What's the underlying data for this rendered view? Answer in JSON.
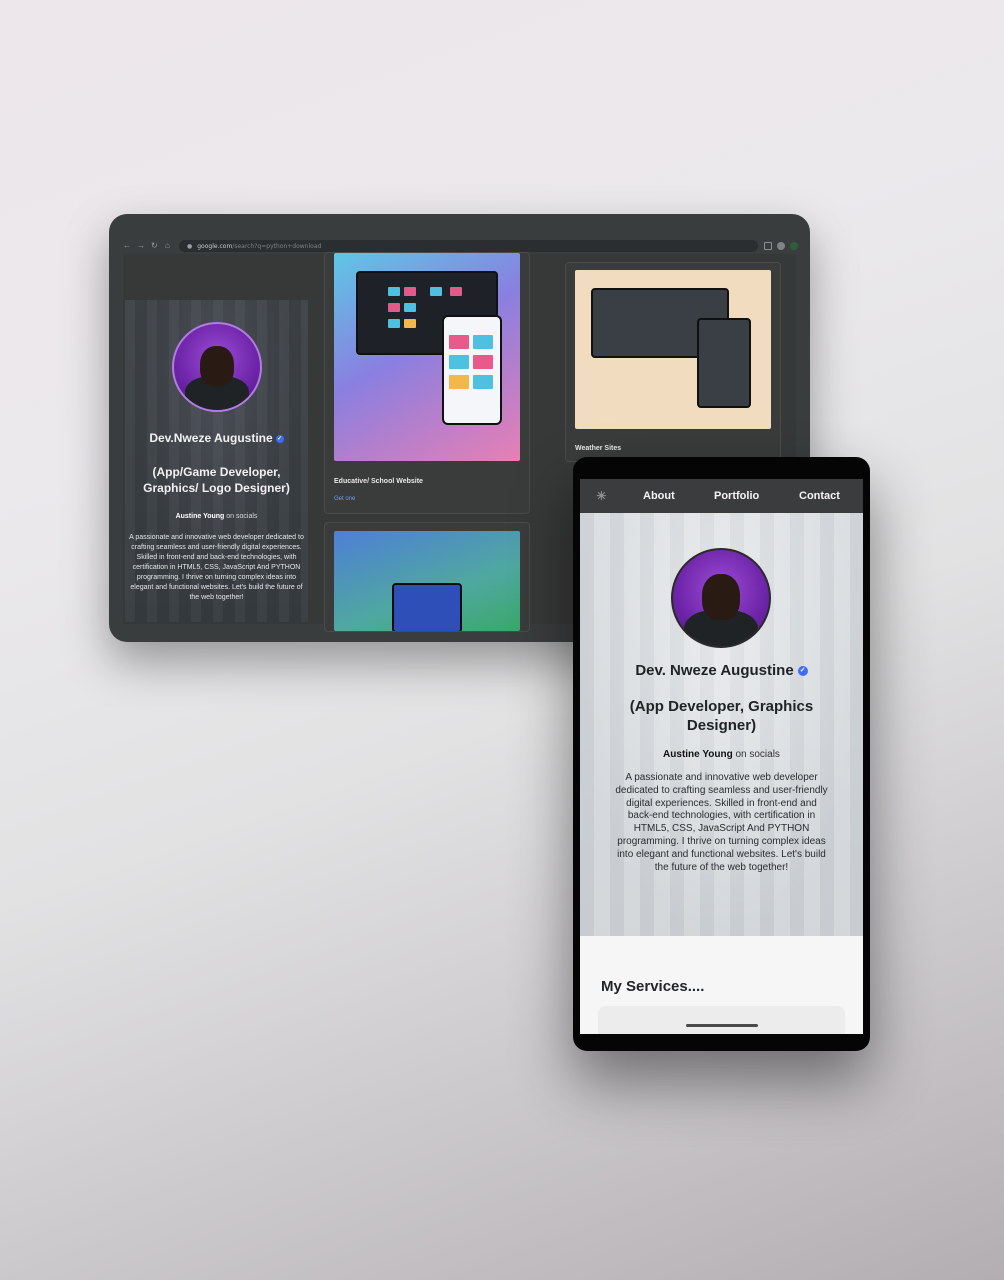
{
  "desktop": {
    "browser": {
      "url_host": "google.com",
      "url_path": "/search?q=python+download"
    },
    "profile": {
      "name": "Dev.Nweze Augustine",
      "verify_mark": "✓",
      "role": "(App/Game Developer, Graphics/ Logo Designer)",
      "social_handle": "Austine Young",
      "social_suffix": " on socials",
      "bio": "A passionate and innovative web developer dedicated to crafting seamless and user-friendly digital experiences. Skilled in front-end and back-end technologies, with certification in HTML5, CSS, JavaScript And PYTHON programming. I thrive on turning complex ideas into elegant and functional websites. Let's build the future of the web together!"
    },
    "projects": [
      {
        "title": "Educative/ School Website",
        "link": "Get one"
      },
      {
        "title": "Weather Sites"
      }
    ]
  },
  "mobile": {
    "nav": {
      "theme_icon": "sun-icon",
      "theme_glyph": "☀",
      "about": "About",
      "portfolio": "Portfolio",
      "contact": "Contact"
    },
    "profile": {
      "name": "Dev. Nweze Augustine",
      "verify_mark": "✓",
      "role": "(App Developer, Graphics Designer)",
      "social_handle": "Austine Young",
      "social_suffix": " on socials",
      "bio": "A passionate and innovative web developer dedicated to crafting seamless and user-friendly digital experiences. Skilled in front-end and back-end technologies, with certification in HTML5, CSS, JavaScript And PYTHON programming. I thrive on turning complex ideas into elegant and functional websites. Let's build the future of the web together!"
    },
    "services_title": "My Services...."
  },
  "colors": {
    "accent_purple": "#7a2fb8",
    "verify_blue": "#3d6bff",
    "link_blue": "#58a8ff",
    "nav_dark": "#3b3c3d"
  }
}
